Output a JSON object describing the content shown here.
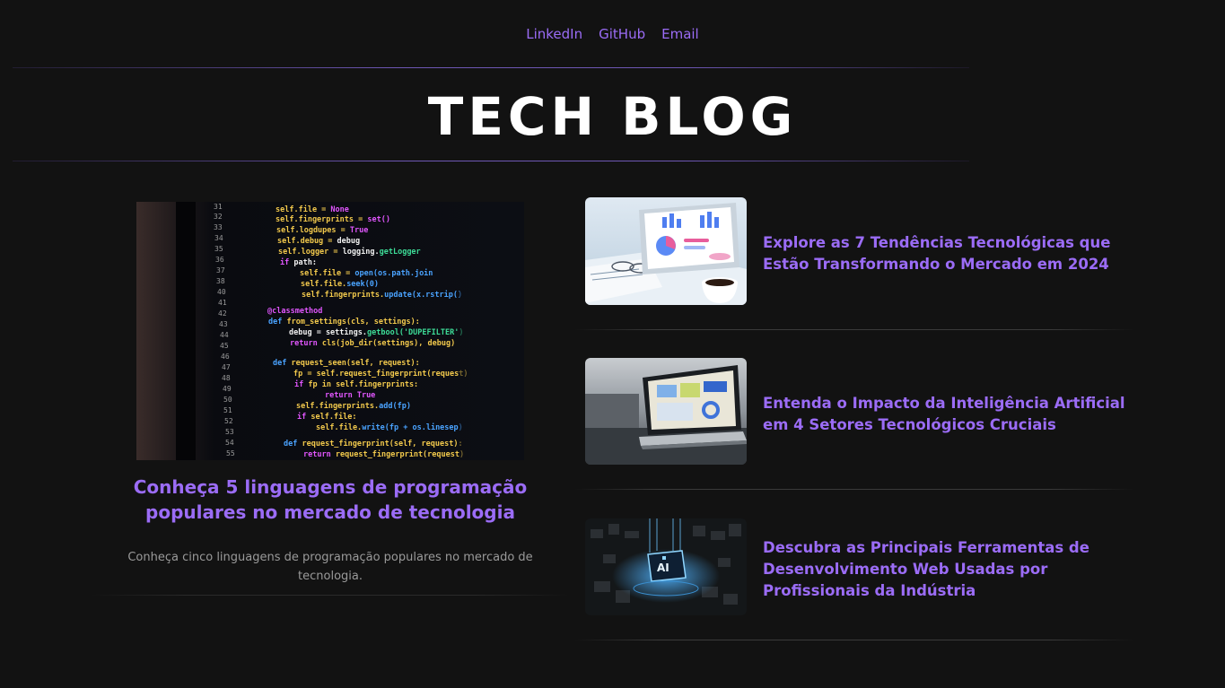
{
  "nav": {
    "links": [
      "LinkedIn",
      "GitHub",
      "Email"
    ]
  },
  "brand": "TECH BLOG",
  "featured": {
    "title": "Conheça 5 linguagens de programação populares no mercado de tecnologia",
    "description": "Conheça cinco linguagens de programação populares no mercado de tecnologia."
  },
  "posts": [
    {
      "title": "Explore as 7 Tendências Tecnológicas que Estão Transformando o Mercado em 2024"
    },
    {
      "title": "Entenda o Impacto da Inteligência Artificial em 4 Setores Tecnológicos Cruciais"
    },
    {
      "title": "Descubra as Principais Ferramentas de Desenvolvimento Web Usadas por Profissionais da Indústria"
    }
  ],
  "colors": {
    "background": "#121212",
    "accent": "#9b6cf6",
    "brand_text": "#ffffff",
    "muted_text": "#9a9a9a"
  }
}
